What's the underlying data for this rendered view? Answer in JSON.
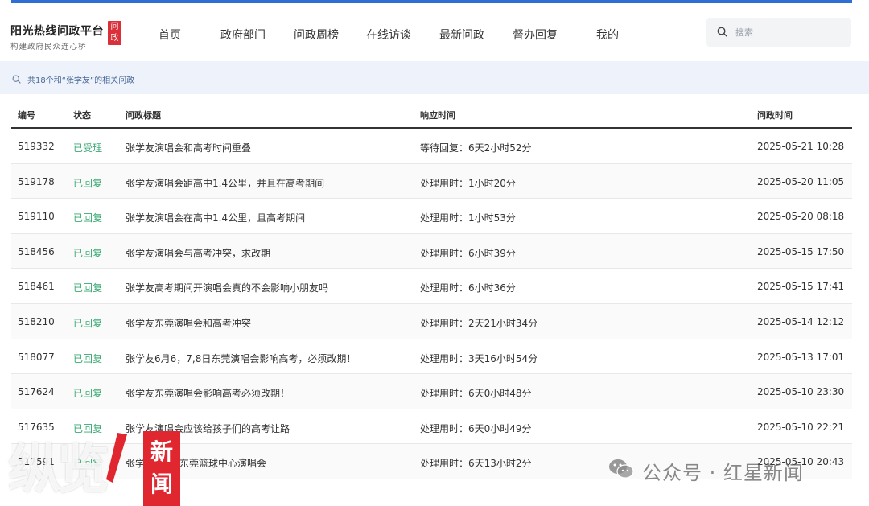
{
  "header": {
    "logo_title": "阳光热线问政平台",
    "logo_subtitle": "构建政府民众连心桥",
    "logo_badge_line1": "问",
    "logo_badge_line2": "政",
    "nav": [
      "首页",
      "政府部门",
      "问政周榜",
      "在线访谈",
      "最新问政",
      "督办回复",
      "我的"
    ],
    "search_placeholder": "搜索"
  },
  "result_text": "共18个和“张学友”的相关问政",
  "table": {
    "headers": [
      "编号",
      "状态",
      "问政标题",
      "响应时间",
      "问政时间"
    ],
    "rows": [
      {
        "id": "519332",
        "status": "已受理",
        "title": "张学友演唱会和高考时间重叠",
        "response": "等待回复：6天2小时52分",
        "time": "2025-05-21 10:28"
      },
      {
        "id": "519178",
        "status": "已回复",
        "title": "张学友演唱会距高中1.4公里，并且在高考期间",
        "response": "处理用时：1小时20分",
        "time": "2025-05-20 11:05"
      },
      {
        "id": "519110",
        "status": "已回复",
        "title": "张学友演唱会在高中1.4公里，且高考期间",
        "response": "处理用时：1小时53分",
        "time": "2025-05-20 08:18"
      },
      {
        "id": "518456",
        "status": "已回复",
        "title": "张学友演唱会与高考冲突，求改期",
        "response": "处理用时：6小时39分",
        "time": "2025-05-15 17:50"
      },
      {
        "id": "518461",
        "status": "已回复",
        "title": "张学友高考期间开演唱会真的不会影响小朋友吗",
        "response": "处理用时：6小时36分",
        "time": "2025-05-15 17:41"
      },
      {
        "id": "518210",
        "status": "已回复",
        "title": "张学友东莞演唱会和高考冲突",
        "response": "处理用时：2天21小时34分",
        "time": "2025-05-14 12:12"
      },
      {
        "id": "518077",
        "status": "已回复",
        "title": "张学友6月6，7,8日东莞演唱会影响高考，必须改期！",
        "response": "处理用时：3天16小时54分",
        "time": "2025-05-13 17:01"
      },
      {
        "id": "517624",
        "status": "已回复",
        "title": "张学友东莞演唱会影响高考必须改期！",
        "response": "处理用时：6天0小时48分",
        "time": "2025-05-10 23:30"
      },
      {
        "id": "517635",
        "status": "已回复",
        "title": "张学友演唱会应该给孩子们的高考让路",
        "response": "处理用时：6天0小时49分",
        "time": "2025-05-10 22:21"
      },
      {
        "id": "517591",
        "status": "已回复",
        "title": "张学友6/7/8东莞篮球中心演唱会",
        "response": "处理用时：6天13小时2分",
        "time": "2025-05-10 20:43"
      }
    ]
  },
  "watermarks": {
    "left_text": "纵览",
    "left_badge": "新闻",
    "right_text": "公众号 · 红星新闻"
  },
  "colors": {
    "accent": "#2d6fd3",
    "status_green": "#3aa873",
    "badge_red": "#d9303a",
    "result_bar_bg": "#eef2fa"
  }
}
